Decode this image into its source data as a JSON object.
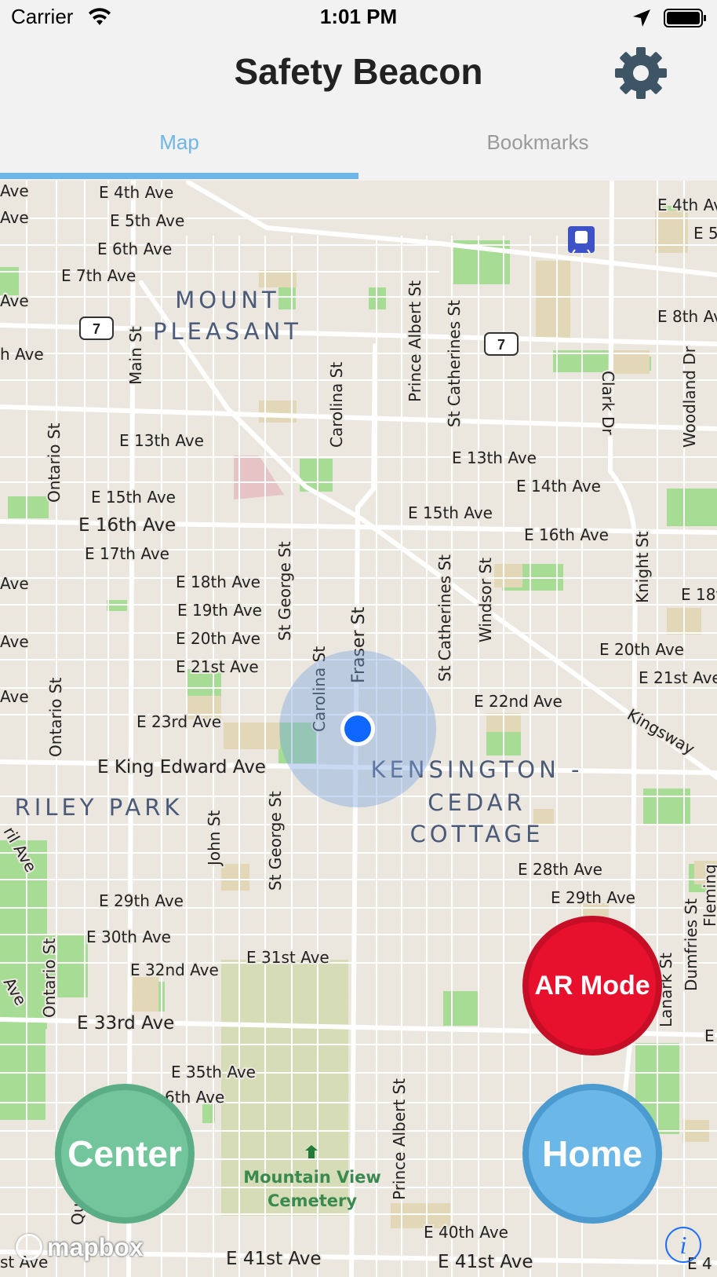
{
  "status_bar": {
    "carrier": "Carrier",
    "time": "1:01 PM",
    "icons": [
      "wifi-icon",
      "location-arrow-icon",
      "battery-icon"
    ]
  },
  "nav": {
    "title": "Safety Beacon",
    "settings_icon": "gear-icon"
  },
  "tabs": [
    {
      "label": "Map",
      "selected": true
    },
    {
      "label": "Bookmarks",
      "selected": false
    }
  ],
  "map": {
    "neighbourhoods": [
      "MOUNT",
      "PLEASANT",
      "KENSINGTON -",
      "CEDAR",
      "COTTAGE",
      "RILEY PARK"
    ],
    "highway_shield": "7",
    "streets": {
      "s4": "E 4th Ave",
      "s5": "E 5th Ave",
      "s6": "E 6th Ave",
      "s7": "E 7th Ave",
      "s4r": "E 4th Av",
      "s5r": "E 5",
      "s8r": "E 8th Av",
      "main": "Main St",
      "carolina": "Carolina St",
      "prince": "Prince Albert St",
      "catherines": "St Catherines St",
      "clark": "Clark Dr",
      "woodland": "Woodland Dr",
      "ontario": "Ontario St",
      "s13": "E 13th Ave",
      "s13b": "E 13th Ave",
      "s14": "E 14th Ave",
      "s15": "E 15th Ave",
      "s15b": "E 15th Ave",
      "s16": "E 16th Ave",
      "s16b": "E 16th Ave",
      "s17": "E 17th Ave",
      "s18": "E 18th Ave",
      "s18r": "E 18t",
      "s19": "E 19th Ave",
      "s20": "E 20th Ave",
      "s20b": "E 20th Ave",
      "s21": "E 21st Ave",
      "s21b": "E 21st Ave",
      "s22": "E 22nd Ave",
      "s23": "E 23rd Ave",
      "stgeorge": "St George St",
      "fraser": "Fraser St",
      "carolina2": "Carolina St",
      "catherines2": "St Catherines St",
      "windsor": "Windsor St",
      "knight": "Knight St",
      "ontario2": "Ontario St",
      "kingsway": "Kingsway",
      "kingedward": "E King Edward Ave",
      "john": "John St",
      "stgeorge2": "St George St",
      "s28": "E 28th Ave",
      "s29": "E 29th Ave",
      "s29b": "E 29th Ave",
      "s30": "E 30th Ave",
      "s31": "E 31st Ave",
      "s32": "E 32nd Ave",
      "s33": "E 33rd Ave",
      "ontario3": "Ontario St",
      "lanark": "Lanark St",
      "dumfries": "Dumfries St",
      "s35": "E 35th Ave",
      "s36": "6th Ave",
      "prince2": "Prince Albert St",
      "s40": "E 40th Ave",
      "s41": "E 41st Ave",
      "s41b": "E 41st Ave",
      "edgeAve": "Ave",
      "edgeAve2": "Ave",
      "edgeAve3": "Ave",
      "edgeAve4": "h Ave",
      "edgeAve5": "Ave",
      "edgeAve6": "Ave",
      "edgeAve7": "Ave",
      "edgeFril": "ril Ave",
      "edgeAve8": "Ave",
      "edgeStAve": "st Ave",
      "edgeQu": "Qu",
      "edgeE": "E",
      "edgeE4": "E 4",
      "edge5": "5",
      "fleming": "Fleming"
    },
    "cemetery_line1": "Mountain View",
    "cemetery_line2": "Cemetery",
    "attribution": "mapbox",
    "info_glyph": "i"
  },
  "buttons": {
    "ar_mode": "AR Mode",
    "center": "Center",
    "home": "Home"
  },
  "colors": {
    "accent": "#6fb6e6",
    "ar": "#e8112d",
    "center": "#73c59c",
    "home": "#6ab7e8",
    "user_dot": "#1067ff"
  }
}
